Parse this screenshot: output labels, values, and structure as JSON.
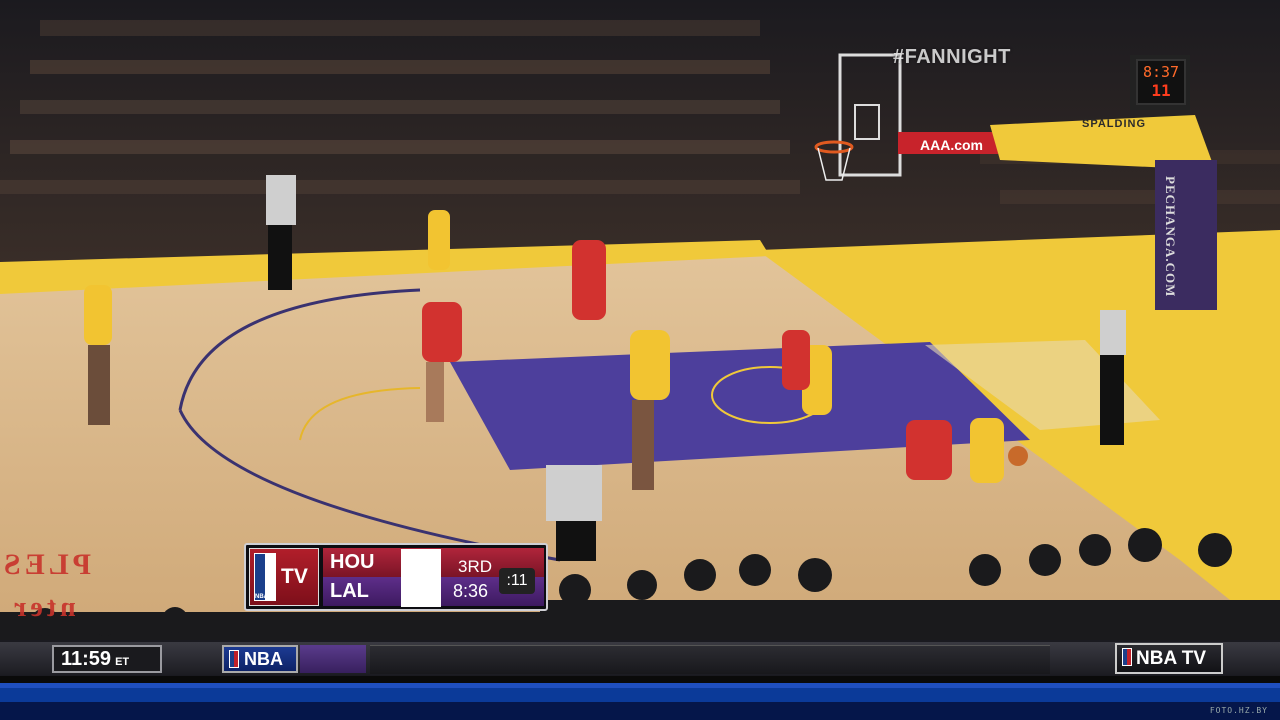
{
  "arena": {
    "hashtag": "#FANNIGHT",
    "shot_clock_game_time": "8:37",
    "shot_clock_seconds": "11",
    "banner_aaa": "AAA.com",
    "banner_spalding": "SPALDING",
    "banner_pechanga": "PECHANGA.COM",
    "floor_text_1": "PLES",
    "floor_text_2": "nter"
  },
  "scorebug": {
    "network": "TV",
    "network_small": "NBA",
    "home_team": "HOU",
    "away_team": "LAL",
    "period": "3RD",
    "game_clock": "8:36",
    "shot_clock": ":11"
  },
  "ticker": {
    "time": "11:59",
    "timezone": "ET",
    "logo": "NBA",
    "channel_logo": "NBA TV",
    "watermark": "FOTO.HZ.BY"
  },
  "colors": {
    "court_wood": "#d8b98a",
    "paint": "#4d3f9c",
    "lakers_gold": "#f2c431",
    "rockets_red": "#d2322f"
  }
}
